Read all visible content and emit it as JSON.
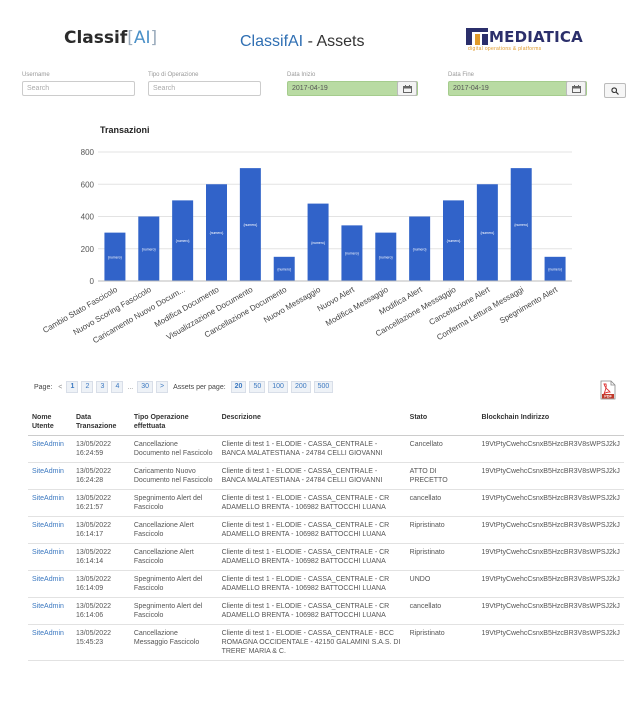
{
  "header": {
    "logo_left": "Classif",
    "logo_left_ai": "AI",
    "title_app": "ClassifAI",
    "title_sep": " - ",
    "title_page": "Assets",
    "logo_right": "MEDIATICA",
    "logo_right_sub": "digital operations & platforms"
  },
  "filters": {
    "username": {
      "label": "Username",
      "placeholder": "Search"
    },
    "tipo": {
      "label": "Tipo di Operazione",
      "placeholder": "Search"
    },
    "data_inizio": {
      "label": "Data Inizio",
      "value": "2017-04-19"
    },
    "data_fine": {
      "label": "Data Fine",
      "value": "2017-04-19"
    }
  },
  "chart_data": {
    "type": "bar",
    "title": "Transazioni",
    "categories": [
      "Cambio Stato Fascicolo",
      "Nuovo Scoring Fascicolo",
      "Caricamento Nuovo Docum...",
      "Modifica Documento",
      "Visualizzazione Documento",
      "Cancellazione Documento",
      "Nuovo Messaggio",
      "Nuovo Alert",
      "Modifica Messaggio",
      "Modifica Alert",
      "Cancellazione Messaggio",
      "Cancellazione Alert",
      "Conferma Lettura Messaggi",
      "Spegnimento Alert"
    ],
    "values": [
      300,
      400,
      500,
      600,
      700,
      150,
      480,
      345,
      300,
      400,
      500,
      600,
      700,
      150
    ],
    "data_label": "{numero}",
    "ylim": [
      0,
      800
    ],
    "yticks": [
      0,
      200,
      400,
      600,
      800
    ],
    "grid": true,
    "bar_color": "#3163c9"
  },
  "pager": {
    "page_label": "Page:",
    "prev": "<",
    "pages": [
      "1",
      "2",
      "3",
      "4"
    ],
    "ellipsis": "...",
    "last": "30",
    "next": ">",
    "per_page_label": "Assets per page:",
    "sizes": [
      "20",
      "50",
      "100",
      "200",
      "500"
    ]
  },
  "table": {
    "headers": [
      "Nome Utente",
      "Data Transazione",
      "Tipo Operazione effettuata",
      "Descrizione",
      "Stato",
      "Blockchain Indirizzo"
    ],
    "rows": [
      {
        "user": "SiteAdmin",
        "date": "13/05/2022 16:24:59",
        "op": "Cancellazione Documento nel Fascicolo",
        "desc": "Cliente di test 1 - ELODIE - CASSA_CENTRALE - BANCA MALATESTIANA - 24784 CELLI GIOVANNI",
        "stato": "Cancellato",
        "addr": "19VtPtyCwehcCsnxB5HzcBR3V8sWPSJ2kJ"
      },
      {
        "user": "SiteAdmin",
        "date": "13/05/2022 16:24:28",
        "op": "Caricamento Nuovo Documento nel Fascicolo",
        "desc": "Cliente di test 1 - ELODIE - CASSA_CENTRALE - BANCA MALATESTIANA - 24784 CELLI GIOVANNI",
        "stato": "ATTO DI PRECETTO",
        "addr": "19VtPtyCwehcCsnxB5HzcBR3V8sWPSJ2kJ"
      },
      {
        "user": "SiteAdmin",
        "date": "13/05/2022 16:21:57",
        "op": "Spegnimento Alert del Fascicolo",
        "desc": "Cliente di test 1 - ELODIE - CASSA_CENTRALE - CR ADAMELLO BRENTA - 106982 BATTOCCHI LUANA",
        "stato": "cancellato",
        "addr": "19VtPtyCwehcCsnxB5HzcBR3V8sWPSJ2kJ"
      },
      {
        "user": "SiteAdmin",
        "date": "13/05/2022 16:14:17",
        "op": "Cancellazione Alert Fascicolo",
        "desc": "Cliente di test 1 - ELODIE - CASSA_CENTRALE - CR ADAMELLO BRENTA - 106982 BATTOCCHI LUANA",
        "stato": "Ripristinato",
        "addr": "19VtPtyCwehcCsnxB5HzcBR3V8sWPSJ2kJ"
      },
      {
        "user": "SiteAdmin",
        "date": "13/05/2022 16:14:14",
        "op": "Cancellazione Alert Fascicolo",
        "desc": "Cliente di test 1 - ELODIE - CASSA_CENTRALE - CR ADAMELLO BRENTA - 106982 BATTOCCHI LUANA",
        "stato": "Ripristinato",
        "addr": "19VtPtyCwehcCsnxB5HzcBR3V8sWPSJ2kJ"
      },
      {
        "user": "SiteAdmin",
        "date": "13/05/2022 16:14:09",
        "op": "Spegnimento Alert del Fascicolo",
        "desc": "Cliente di test 1 - ELODIE - CASSA_CENTRALE - CR ADAMELLO BRENTA - 106982 BATTOCCHI LUANA",
        "stato": "UNDO",
        "addr": "19VtPtyCwehcCsnxB5HzcBR3V8sWPSJ2kJ"
      },
      {
        "user": "SiteAdmin",
        "date": "13/05/2022 16:14:06",
        "op": "Spegnimento Alert del Fascicolo",
        "desc": "Cliente di test 1 - ELODIE - CASSA_CENTRALE - CR ADAMELLO BRENTA - 106982 BATTOCCHI LUANA",
        "stato": "cancellato",
        "addr": "19VtPtyCwehcCsnxB5HzcBR3V8sWPSJ2kJ"
      },
      {
        "user": "SiteAdmin",
        "date": "13/05/2022 15:45:23",
        "op": "Cancellazione Messaggio Fascicolo",
        "desc": "Cliente di test 1 - ELODIE - CASSA_CENTRALE - BCC ROMAGNA OCCIDENTALE - 42150 GALAMINI S.A.S. DI TRERE' MARIA & C.",
        "stato": "Ripristinato",
        "addr": "19VtPtyCwehcCsnxB5HzcBR3V8sWPSJ2kJ"
      }
    ]
  }
}
